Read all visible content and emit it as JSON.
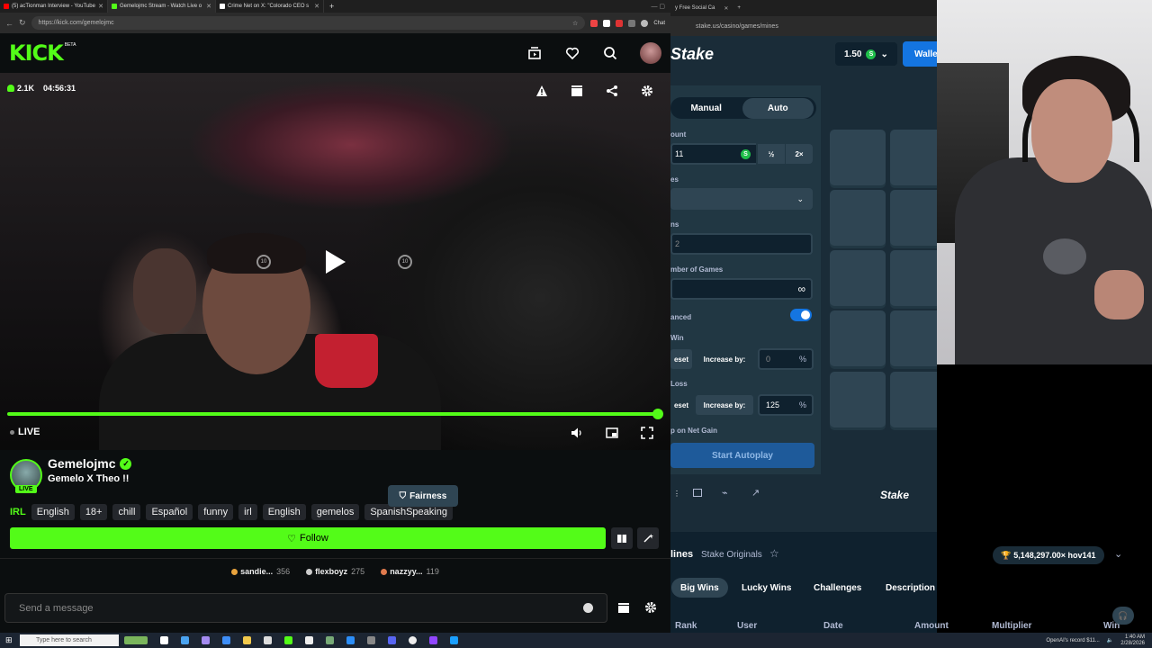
{
  "browser": {
    "tabs": [
      {
        "title": "(5) acTionman Interview - YouTube",
        "color": "#ff0000"
      },
      {
        "title": "Gemelojmc Stream - Watch Live o",
        "color": "#53fc18"
      },
      {
        "title": "Crime Net on X: \"Colorado CEO s",
        "color": "#ffffff"
      }
    ],
    "url": "https://kick.com/gemelojmc",
    "chat_label": "Chat"
  },
  "kick": {
    "logo": "KICK",
    "beta": "BETA",
    "viewers": "2.1K",
    "uptime": "04:56:31",
    "live_label": "LIVE",
    "channel_name": "Gemelojmc",
    "stream_title": "Gemelo X Theo !!",
    "avatar_badge": "LIVE",
    "category": "IRL",
    "tags": [
      "English",
      "18+",
      "chill",
      "Español",
      "funny",
      "irl",
      "English",
      "gemelos",
      "SpanishSpeaking"
    ],
    "follow_label": "Follow",
    "leaderboard": [
      {
        "name": "sandie...",
        "count": "356",
        "color": "#e8a33d"
      },
      {
        "name": "flexboyz",
        "count": "275",
        "color": "#cccccc"
      },
      {
        "name": "nazzyy...",
        "count": "119",
        "color": "#e07a4d"
      }
    ],
    "chat_placeholder": "Send a message",
    "skip_back": "10",
    "skip_fwd": "10"
  },
  "stake": {
    "tab_title": "y Free Social Ca",
    "url": "stake.us/casino/games/mines",
    "brand": "Stake",
    "balance": "1.50",
    "coin": "S",
    "wallet_label": "Walle",
    "mode_manual": "Manual",
    "mode_auto": "Auto",
    "amount_label": "ount",
    "amount_value": "11",
    "half": "½",
    "double": "2×",
    "mines_label": "es",
    "gems_label": "ns",
    "gems_value": "2",
    "games_label": "mber of Games",
    "games_value": "∞",
    "advanced_label": "anced",
    "on_win_label": "Win",
    "on_loss_label": "Loss",
    "reset_label": "eset",
    "increase_label": "Increase by:",
    "win_increase": "0",
    "loss_increase": "125",
    "percent": "%",
    "stop_net_gain": "p on Net Gain",
    "start_autoplay": "Start Autoplay",
    "footer_brand": "Stake",
    "fairness": "Fairness",
    "game_title": "lines",
    "originals": "Stake Originals",
    "top_win": "5,148,297.00× hov141",
    "bottom_tabs": [
      "Big Wins",
      "Lucky Wins",
      "Challenges",
      "Description"
    ],
    "columns": [
      "Rank",
      "User",
      "Date",
      "Amount",
      "Multiplier",
      "Win"
    ]
  },
  "taskbar": {
    "search_placeholder": "Type here to search",
    "tray_text": "OpenAI's record $11...",
    "time": "1:40 AM",
    "date": "2/28/2026"
  }
}
